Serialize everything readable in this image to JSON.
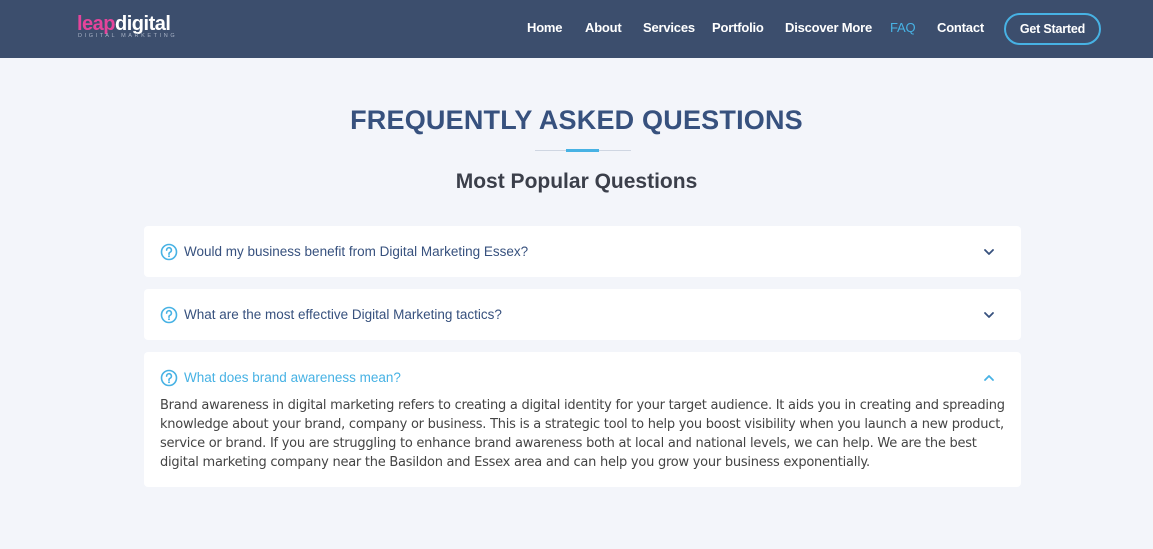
{
  "header": {
    "logo": {
      "part1": "leap",
      "part2": "digital",
      "tagline": "DIGITAL MARKETING"
    },
    "nav": [
      {
        "label": "Home",
        "active": false
      },
      {
        "label": "About",
        "active": false
      },
      {
        "label": "Services",
        "active": false
      },
      {
        "label": "Portfolio",
        "active": false
      },
      {
        "label": "Discover More",
        "active": false
      },
      {
        "label": "FAQ",
        "active": true
      },
      {
        "label": "Contact",
        "active": false
      }
    ],
    "cta_label": "Get Started"
  },
  "section": {
    "title": "FREQUENTLY ASKED QUESTIONS",
    "subtitle": "Most Popular Questions"
  },
  "faq": [
    {
      "question": "Would my business benefit from Digital Marketing Essex?",
      "expanded": false,
      "icon": "question-circle-icon"
    },
    {
      "question": "What are the most effective Digital Marketing tactics?",
      "expanded": false,
      "icon": "question-circle-icon"
    },
    {
      "question": "What does brand awareness mean?",
      "expanded": true,
      "icon": "question-circle-icon",
      "answer": "Brand awareness in digital marketing refers to creating a digital identity for your target audience. It aids you in creating and spreading knowledge about your brand, company or business. This is a strategic tool to help you boost visibility when you launch a new product, service or brand. If you are struggling to enhance brand awareness both at local and national levels, we can help. We are the best digital marketing company near the Basildon and Essex area and can help you grow your business exponentially."
    }
  ],
  "colors": {
    "header_bg": "#3c4e6d",
    "accent": "#47b2e4",
    "heading": "#37517e",
    "logo_pink": "#e5449b",
    "page_bg": "#f3f5fa"
  }
}
